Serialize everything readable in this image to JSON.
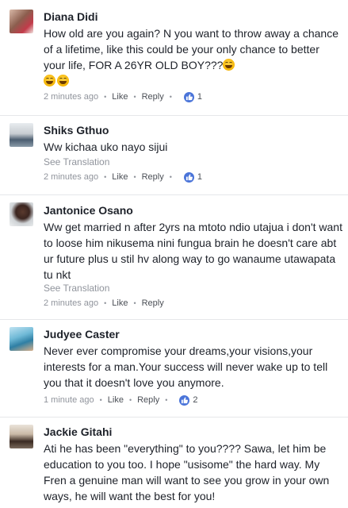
{
  "comments": [
    {
      "name": "Diana Didi",
      "text": "How old are you again? N you want to throw away a chance of a lifetime, like this could be your only chance to better your life, FOR A 26YR OLD BOY???",
      "emoji_count": 3,
      "time": "2 minutes ago",
      "like": "Like",
      "reply": "Reply",
      "likes": "1"
    },
    {
      "name": "Shiks Gthuo",
      "text": "Ww kichaa uko nayo sijui",
      "see_translation": "See Translation",
      "time": "2 minutes ago",
      "like": "Like",
      "reply": "Reply",
      "likes": "1"
    },
    {
      "name": "Jantonice Osano",
      "text": "Ww get married n after 2yrs na mtoto ndio utajua i don't want to loose him nikusema nini fungua brain he doesn't care abt ur future plus u stil hv along way to go wanaume utawapata tu nkt",
      "see_translation": "See Translation",
      "time": "2 minutes ago",
      "like": "Like",
      "reply": "Reply"
    },
    {
      "name": "Judyee Caster",
      "text": "Never ever compromise your dreams,your visions,your interests for a man.Your success will never wake up to tell you that it doesn't love you anymore.",
      "time": "1 minute ago",
      "like": "Like",
      "reply": "Reply",
      "likes": "2"
    },
    {
      "name": "Jackie Gitahi",
      "text": "Ati he has been \"everything\" to you???? Sawa, let him be education to you too. I hope \"usisome\" the hard way. My Fren a genuine man will want to see you grow in your own ways, he will want the best for you!"
    }
  ],
  "colors": {
    "name": "#1d2129",
    "meta": "#90949c",
    "like_badge": "#4a74d9",
    "divider": "#e6e7ea"
  }
}
